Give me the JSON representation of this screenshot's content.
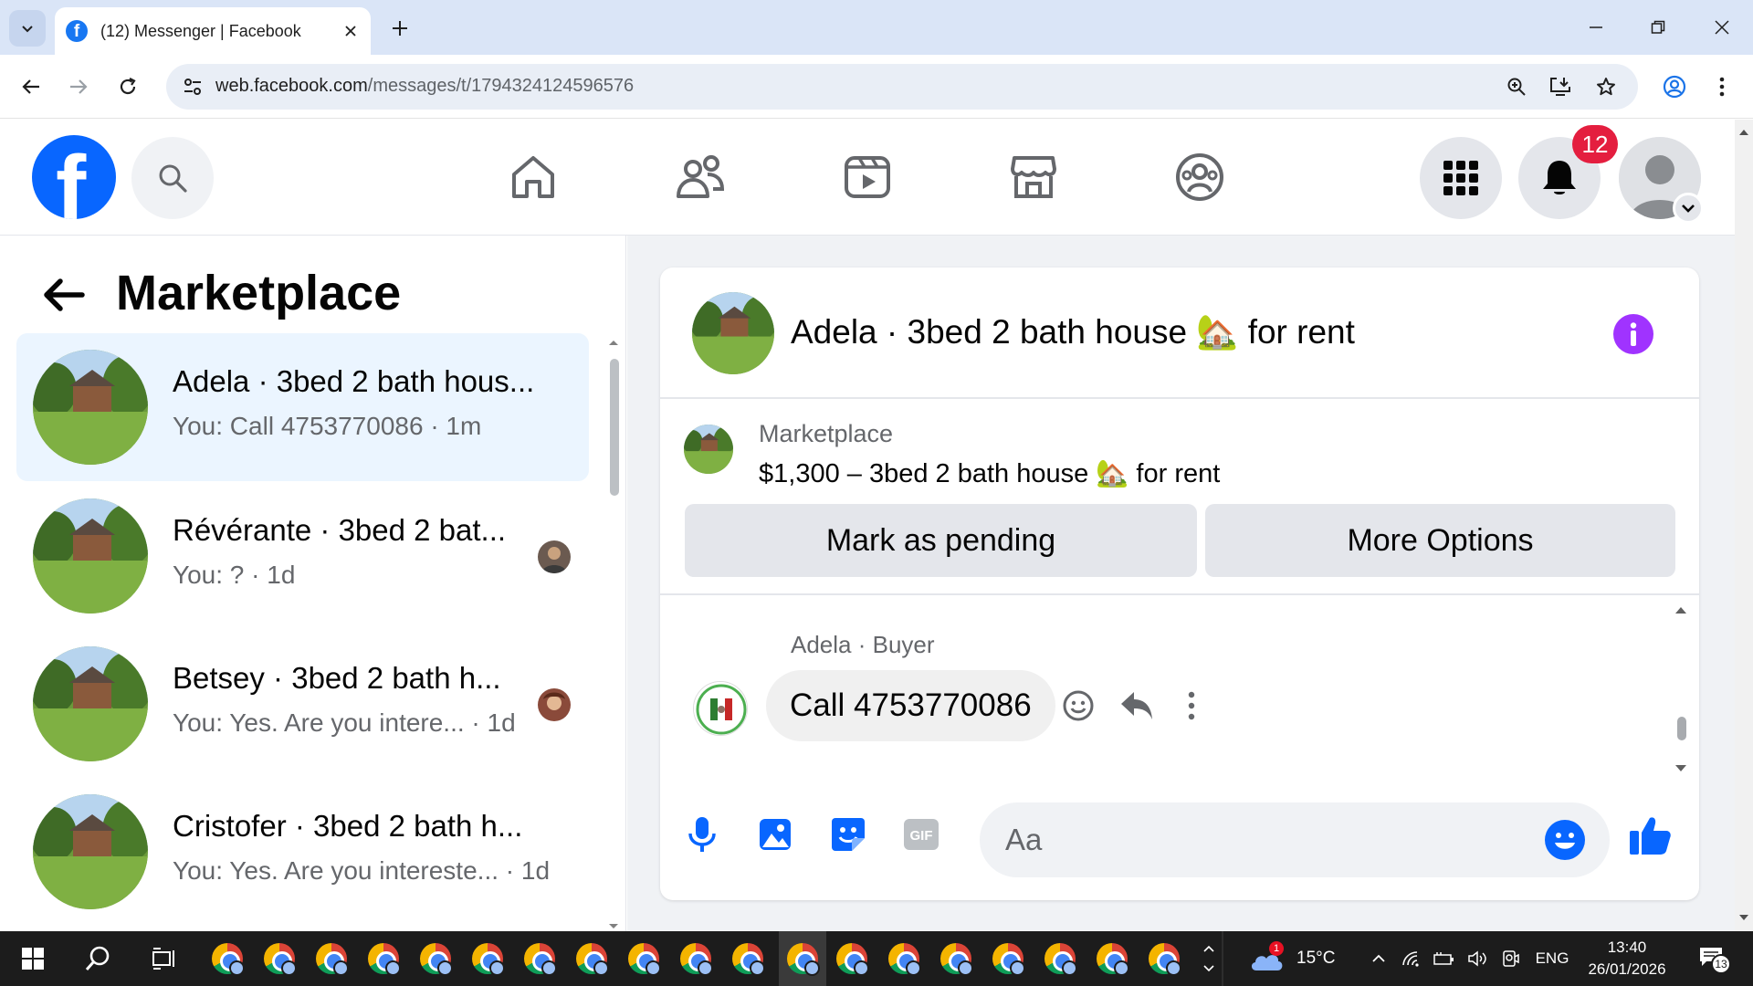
{
  "browser": {
    "tab_title": "(12) Messenger | Facebook",
    "url_host": "web.facebook.com",
    "url_path": "/messages/t/1794324124596576"
  },
  "facebook": {
    "notification_count": "12",
    "logo_letter": "f"
  },
  "left_panel": {
    "title": "Marketplace",
    "conversations": [
      {
        "name": "Adela · 3bed 2 bath hous...",
        "preview": "You: Call 4753770086 · 1m",
        "active": true
      },
      {
        "name": "Révérante · 3bed 2 bat...",
        "preview": "You: ? · 1d",
        "active": false
      },
      {
        "name": "Betsey · 3bed 2 bath h...",
        "preview": "You: Yes. Are you intere... · 1d",
        "active": false
      },
      {
        "name": "Cristofer · 3bed 2 bath h...",
        "preview": "You: Yes. Are you intereste... · 1d",
        "active": false
      }
    ]
  },
  "chat": {
    "title": "Adela · 3bed 2 bath house 🏡 for rent",
    "listing_label": "Marketplace",
    "listing_price": "$1,300 – 3bed 2 bath house 🏡 for rent",
    "mark_pending_label": "Mark as pending",
    "more_options_label": "More Options",
    "message_sender": "Adela · Buyer",
    "message_text": "Call 4753770086",
    "composer_placeholder": "Aa"
  },
  "taskbar": {
    "weather": "15°C",
    "weather_badge": "1",
    "language": "ENG",
    "time": "13:40",
    "date": "26/01/2026",
    "notification_count": "13"
  },
  "colors": {
    "fb_blue": "#0866ff",
    "active_conv_bg": "#ebf5ff",
    "badge_red": "#e41e3f",
    "info_purple": "#a033ff"
  }
}
